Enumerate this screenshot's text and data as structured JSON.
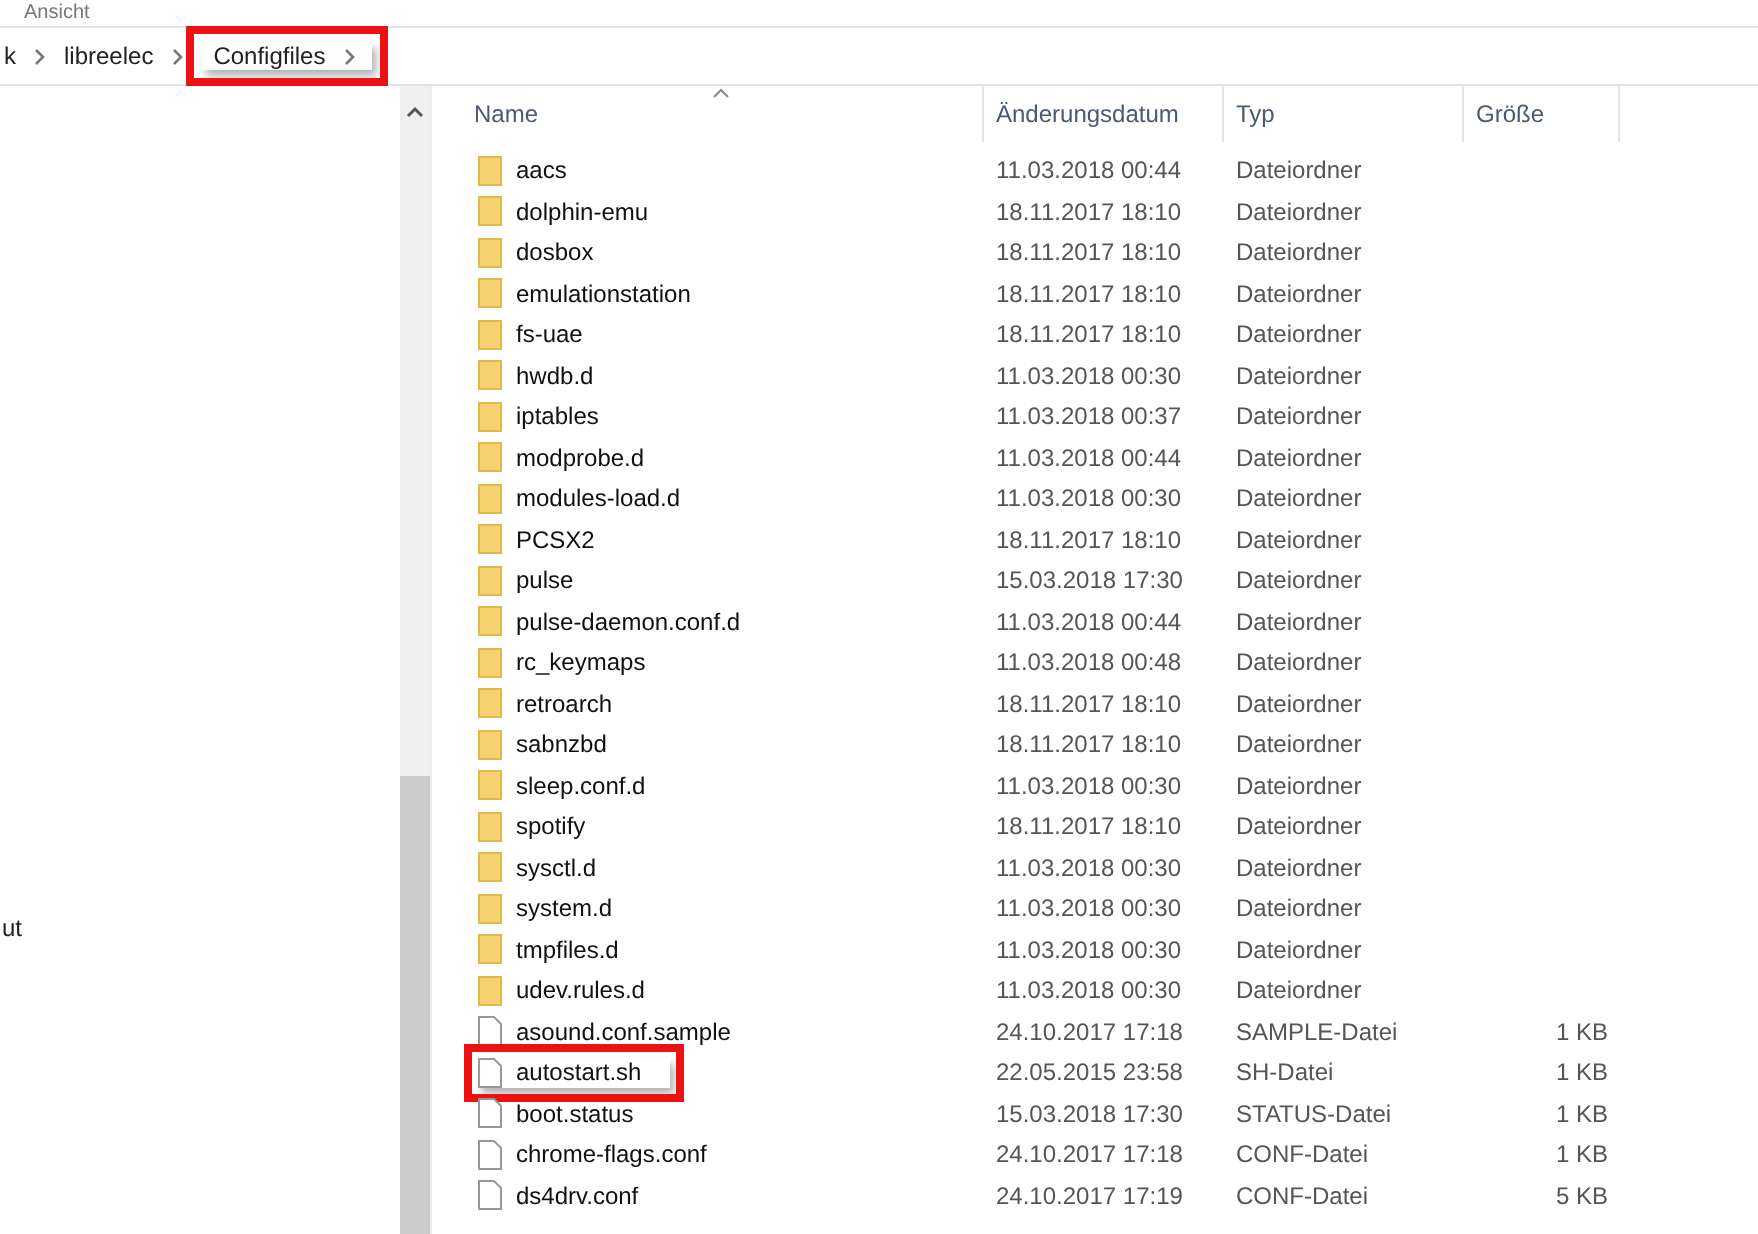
{
  "ribbon": {
    "tab": "Ansicht"
  },
  "breadcrumb": [
    {
      "label": "k",
      "highlighted": false
    },
    {
      "label": "libreelec",
      "highlighted": false
    },
    {
      "label": "Configfiles",
      "highlighted": true
    }
  ],
  "nav_pane": {
    "items": [
      "ut"
    ]
  },
  "columns": [
    "Name",
    "Änderungsdatum",
    "Typ",
    "Größe"
  ],
  "rows": [
    {
      "kind": "folder",
      "name": "aacs",
      "date": "11.03.2018 00:44",
      "type": "Dateiordner",
      "highlighted": false
    },
    {
      "kind": "folder",
      "name": "dolphin-emu",
      "date": "18.11.2017 18:10",
      "type": "Dateiordner",
      "highlighted": false
    },
    {
      "kind": "folder",
      "name": "dosbox",
      "date": "18.11.2017 18:10",
      "type": "Dateiordner",
      "highlighted": false
    },
    {
      "kind": "folder",
      "name": "emulationstation",
      "date": "18.11.2017 18:10",
      "type": "Dateiordner",
      "highlighted": false
    },
    {
      "kind": "folder",
      "name": "fs-uae",
      "date": "18.11.2017 18:10",
      "type": "Dateiordner",
      "highlighted": false
    },
    {
      "kind": "folder",
      "name": "hwdb.d",
      "date": "11.03.2018 00:30",
      "type": "Dateiordner",
      "highlighted": false
    },
    {
      "kind": "folder",
      "name": "iptables",
      "date": "11.03.2018 00:37",
      "type": "Dateiordner",
      "highlighted": false
    },
    {
      "kind": "folder",
      "name": "modprobe.d",
      "date": "11.03.2018 00:44",
      "type": "Dateiordner",
      "highlighted": false
    },
    {
      "kind": "folder",
      "name": "modules-load.d",
      "date": "11.03.2018 00:30",
      "type": "Dateiordner",
      "highlighted": false
    },
    {
      "kind": "folder",
      "name": "PCSX2",
      "date": "18.11.2017 18:10",
      "type": "Dateiordner",
      "highlighted": false
    },
    {
      "kind": "folder",
      "name": "pulse",
      "date": "15.03.2018 17:30",
      "type": "Dateiordner",
      "highlighted": false
    },
    {
      "kind": "folder",
      "name": "pulse-daemon.conf.d",
      "date": "11.03.2018 00:44",
      "type": "Dateiordner",
      "highlighted": false
    },
    {
      "kind": "folder",
      "name": "rc_keymaps",
      "date": "11.03.2018 00:48",
      "type": "Dateiordner",
      "highlighted": false
    },
    {
      "kind": "folder",
      "name": "retroarch",
      "date": "18.11.2017 18:10",
      "type": "Dateiordner",
      "highlighted": false
    },
    {
      "kind": "folder",
      "name": "sabnzbd",
      "date": "18.11.2017 18:10",
      "type": "Dateiordner",
      "highlighted": false
    },
    {
      "kind": "folder",
      "name": "sleep.conf.d",
      "date": "11.03.2018 00:30",
      "type": "Dateiordner",
      "highlighted": false
    },
    {
      "kind": "folder",
      "name": "spotify",
      "date": "18.11.2017 18:10",
      "type": "Dateiordner",
      "highlighted": false
    },
    {
      "kind": "folder",
      "name": "sysctl.d",
      "date": "11.03.2018 00:30",
      "type": "Dateiordner",
      "highlighted": false
    },
    {
      "kind": "folder",
      "name": "system.d",
      "date": "11.03.2018 00:30",
      "type": "Dateiordner",
      "highlighted": false
    },
    {
      "kind": "folder",
      "name": "tmpfiles.d",
      "date": "11.03.2018 00:30",
      "type": "Dateiordner",
      "highlighted": false
    },
    {
      "kind": "folder",
      "name": "udev.rules.d",
      "date": "11.03.2018 00:30",
      "type": "Dateiordner",
      "highlighted": false
    },
    {
      "kind": "file",
      "name": "asound.conf.sample",
      "date": "24.10.2017 17:18",
      "type": "SAMPLE-Datei",
      "size": "1 KB",
      "highlighted": false
    },
    {
      "kind": "file",
      "name": "autostart.sh",
      "date": "22.05.2015 23:58",
      "type": "SH-Datei",
      "size": "1 KB",
      "highlighted": true
    },
    {
      "kind": "file",
      "name": "boot.status",
      "date": "15.03.2018 17:30",
      "type": "STATUS-Datei",
      "size": "1 KB",
      "highlighted": false
    },
    {
      "kind": "file",
      "name": "chrome-flags.conf",
      "date": "24.10.2017 17:18",
      "type": "CONF-Datei",
      "size": "1 KB",
      "highlighted": false
    },
    {
      "kind": "file",
      "name": "ds4drv.conf",
      "date": "24.10.2017 17:19",
      "type": "CONF-Datei",
      "size": "5 KB",
      "highlighted": false
    }
  ]
}
